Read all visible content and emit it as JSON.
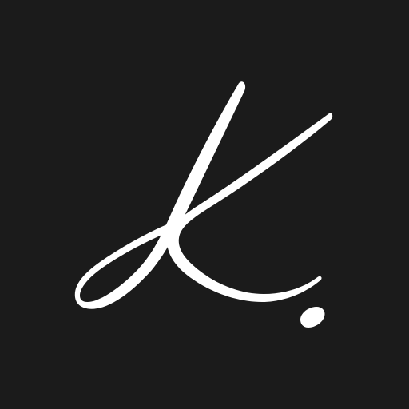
{
  "logo": {
    "monogram": "K.",
    "background_color": "#1b1b1b",
    "ink_color": "#ffffff"
  }
}
